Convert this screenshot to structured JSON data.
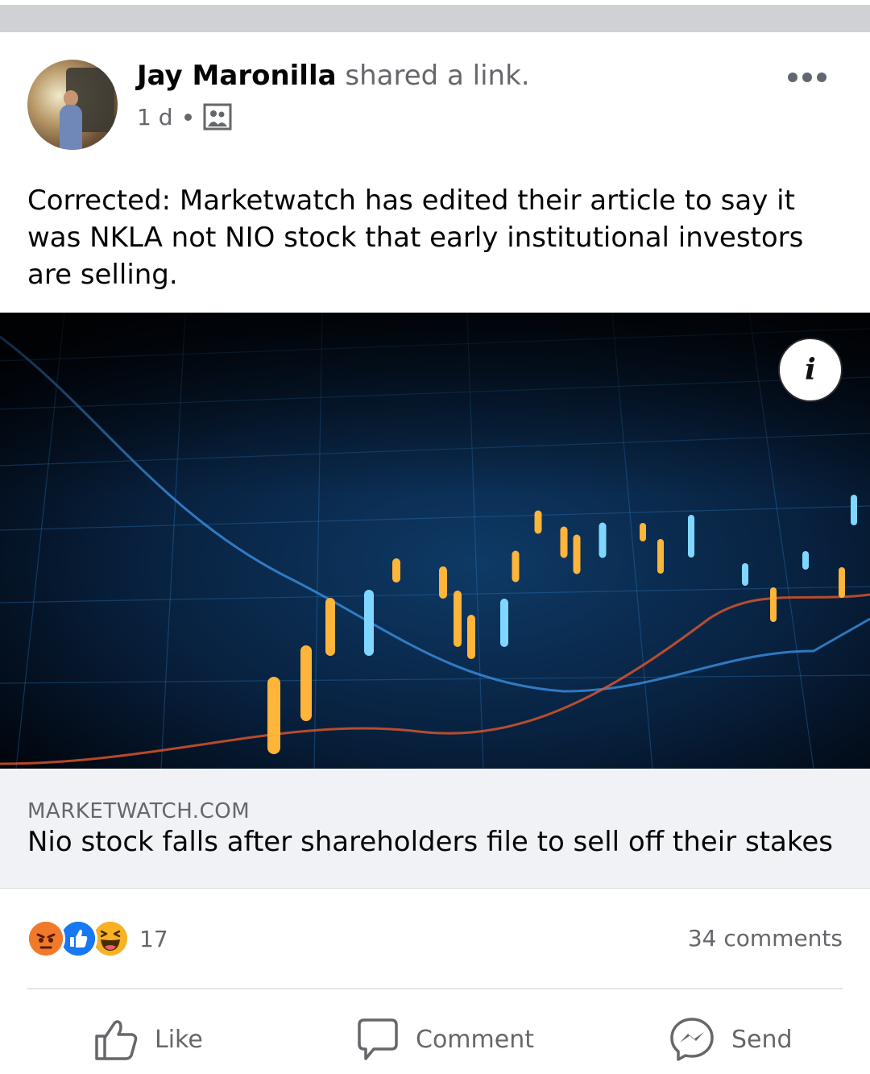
{
  "post": {
    "author": "Jay Maronilla",
    "action": "shared a link.",
    "time": "1 d",
    "audience_icon": "public-group-icon",
    "text": "Corrected: Marketwatch has edited their article to say it was NKLA not NIO stock that early institutional investors are selling."
  },
  "link": {
    "domain": "MARKETWATCH.COM",
    "title": "Nio stock falls after shareholders file to sell off their stakes"
  },
  "reactions": {
    "types": [
      "angry",
      "like",
      "haha"
    ],
    "count": "17",
    "comments": "34 comments"
  },
  "actions": {
    "like": "Like",
    "comment": "Comment",
    "send": "Send"
  },
  "colors": {
    "like_blue": "#1877f2",
    "angry_orange": "#f0571b",
    "haha_yellow": "#f7b125",
    "secondary_text": "#65676b"
  }
}
